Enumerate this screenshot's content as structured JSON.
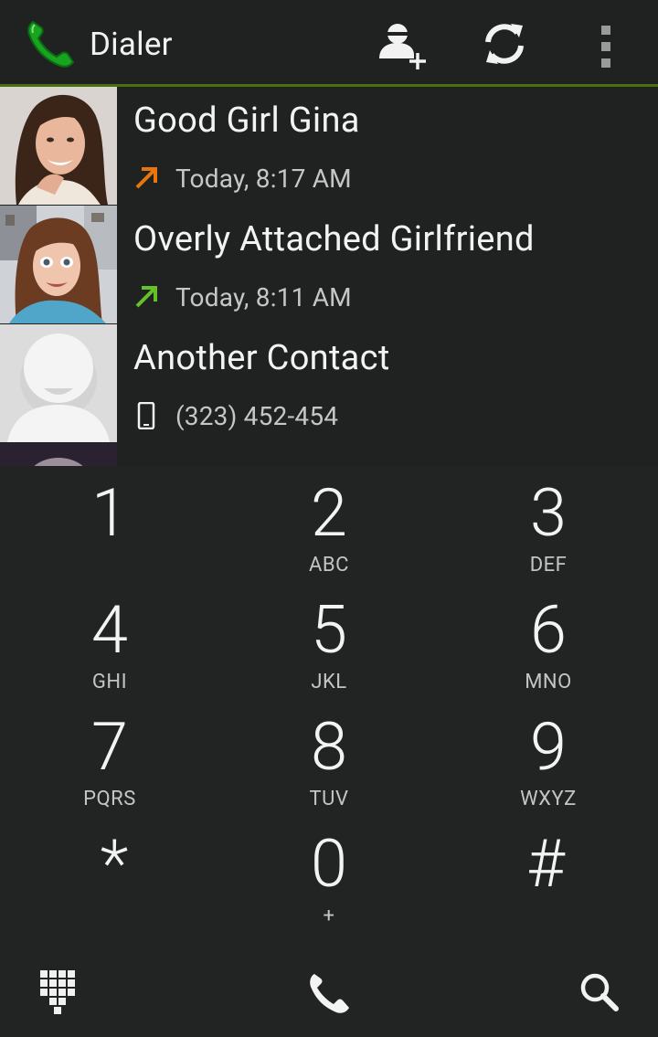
{
  "app": {
    "title": "Dialer"
  },
  "actionbar": {
    "icons": [
      "phone-app-icon",
      "add-contact-icon",
      "sync-icon",
      "overflow-menu-icon"
    ]
  },
  "contacts": [
    {
      "name": "Good Girl Gina",
      "detail": "Today, 8:17 AM",
      "detail_icon": "outgoing-call-icon",
      "icon_color": "#e8760d"
    },
    {
      "name": "Overly Attached Girlfriend",
      "detail": "Today, 8:11 AM",
      "detail_icon": "outgoing-call-icon",
      "icon_color": "#64c228"
    },
    {
      "name": "Another Contact",
      "detail": "(323) 452-454",
      "detail_icon": "mobile-phone-icon",
      "icon_color": "#f0f0f0"
    }
  ],
  "dialpad": {
    "keys": [
      {
        "digit": "1",
        "letters": ""
      },
      {
        "digit": "2",
        "letters": "ABC"
      },
      {
        "digit": "3",
        "letters": "DEF"
      },
      {
        "digit": "4",
        "letters": "GHI"
      },
      {
        "digit": "5",
        "letters": "JKL"
      },
      {
        "digit": "6",
        "letters": "MNO"
      },
      {
        "digit": "7",
        "letters": "PQRS"
      },
      {
        "digit": "8",
        "letters": "TUV"
      },
      {
        "digit": "9",
        "letters": "WXYZ"
      },
      {
        "digit": "*",
        "letters": ""
      },
      {
        "digit": "0",
        "letters": "+"
      },
      {
        "digit": "#",
        "letters": ""
      }
    ]
  },
  "bottombar": {
    "icons": [
      "dialpad-toggle-icon",
      "call-icon",
      "search-icon"
    ]
  },
  "colors": {
    "accent_green": "#4a6f0f",
    "outgoing_orange": "#e8760d",
    "outgoing_green": "#64c228",
    "background": "#1f2221"
  }
}
